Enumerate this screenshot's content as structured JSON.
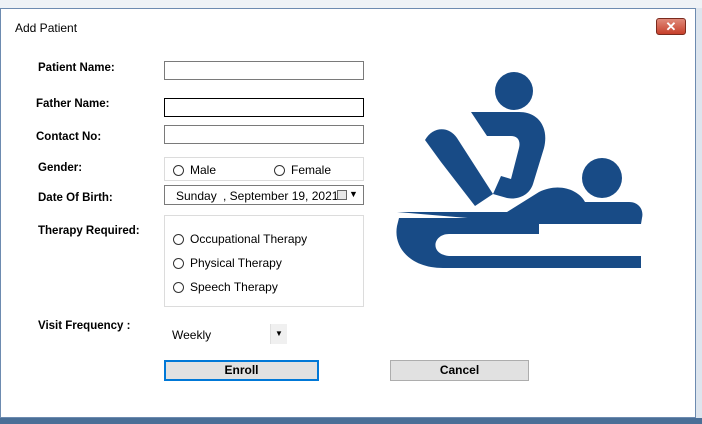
{
  "window": {
    "title": "Add Patient",
    "close_label": "✕"
  },
  "form": {
    "patient_name": {
      "label": "Patient Name:",
      "value": ""
    },
    "father_name": {
      "label": "Father Name:",
      "value": ""
    },
    "contact_no": {
      "label": "Contact No:",
      "value": ""
    },
    "gender": {
      "label": "Gender:",
      "options": [
        "Male",
        "Female"
      ],
      "selected": null
    },
    "dob": {
      "label": "Date Of Birth:",
      "day": "Sunday",
      "date": ", September 19, 2021"
    },
    "therapy": {
      "label": "Therapy Required:",
      "options": [
        "Occupational Therapy",
        "Physical Therapy",
        "Speech Therapy"
      ],
      "selected": null
    },
    "visit_frequency": {
      "label": "Visit Frequency :",
      "value": "Weekly"
    }
  },
  "buttons": {
    "enroll": "Enroll",
    "cancel": "Cancel"
  },
  "colors": {
    "icon": "#184b86",
    "accent": "#0078d7"
  },
  "icons": {
    "illustration": "physical-therapy-icon"
  }
}
